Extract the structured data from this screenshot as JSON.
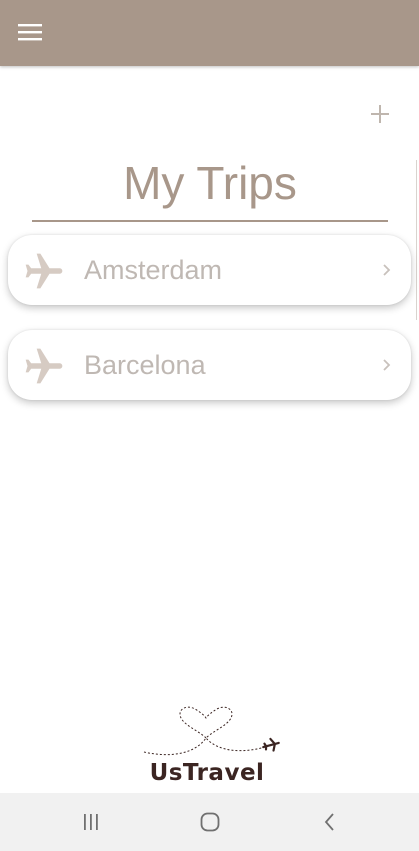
{
  "app_bar": {
    "background": "#a8978a",
    "menu_icon": "hamburger-menu-icon"
  },
  "add_button": {
    "icon": "plus-icon",
    "label": "+"
  },
  "page": {
    "title": "My Trips",
    "accent": "#a8978a"
  },
  "trips": [
    {
      "name": "Amsterdam",
      "icon": "airplane-icon"
    },
    {
      "name": "Barcelona",
      "icon": "airplane-icon"
    }
  ],
  "footer": {
    "logo_text": "UsTravel",
    "logo_color": "#3b2522"
  },
  "system_nav": {
    "recents_icon": "recents-icon",
    "home_icon": "home-icon",
    "back_icon": "back-icon"
  }
}
